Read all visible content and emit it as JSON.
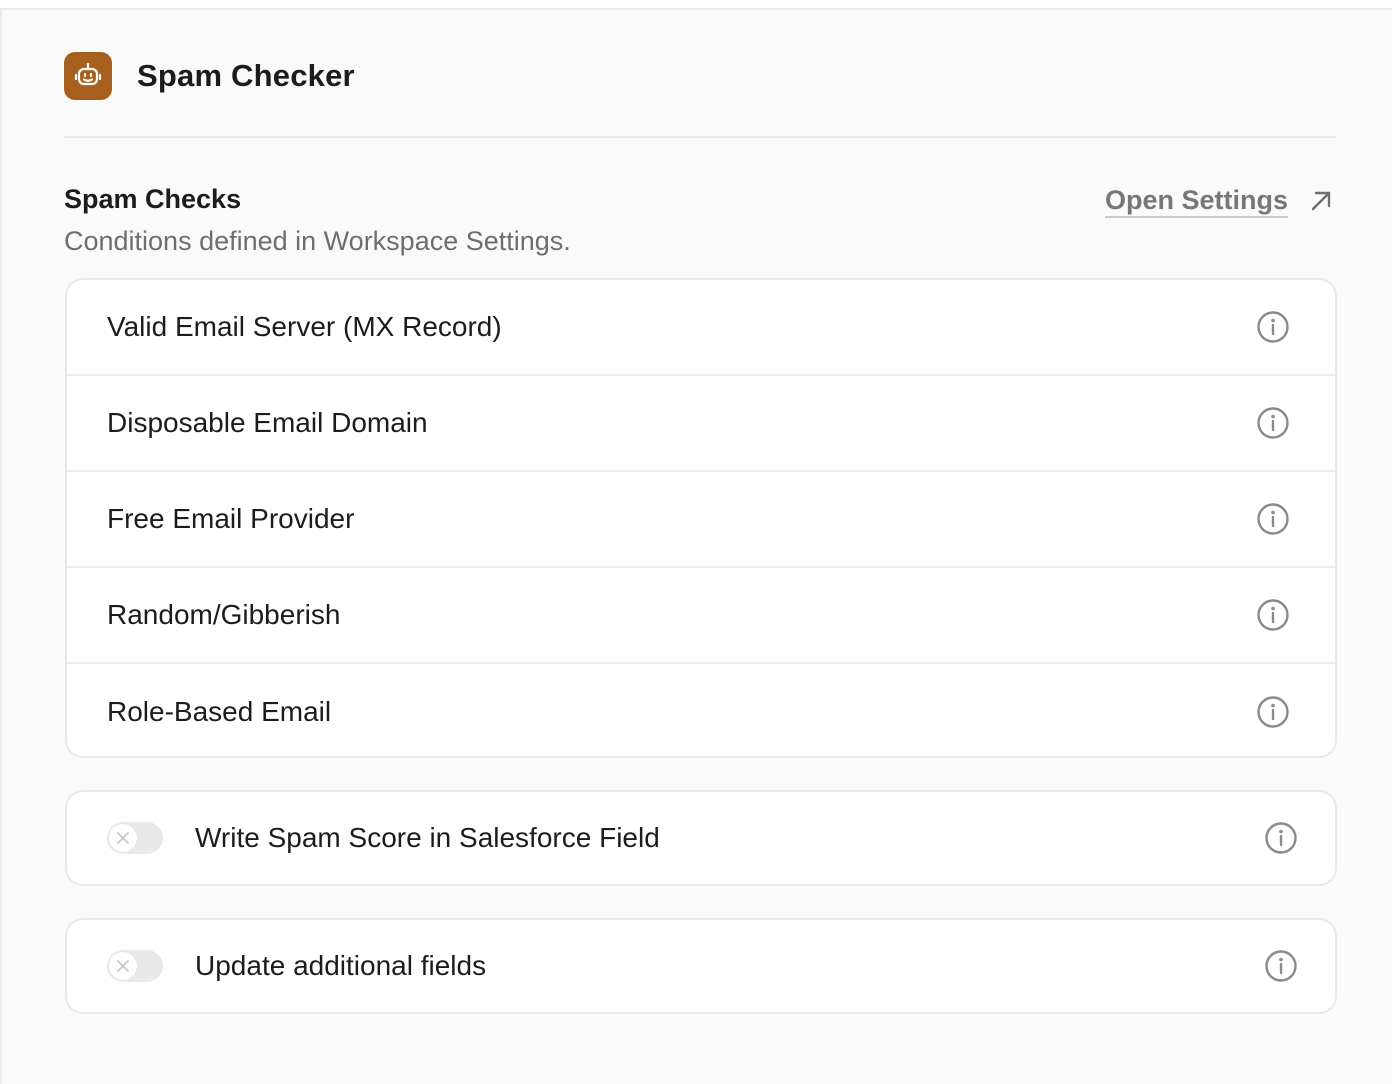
{
  "app": {
    "title": "Spam Checker",
    "icon": "robot-icon",
    "accent_color": "#a7601d"
  },
  "spam_checks": {
    "title": "Spam Checks",
    "subtitle": "Conditions defined in Workspace Settings.",
    "open_settings_label": "Open Settings",
    "open_settings_icon": "arrow-up-right-icon",
    "items": [
      {
        "label": "Valid Email Server (MX Record)",
        "icon": "info-icon"
      },
      {
        "label": "Disposable Email Domain",
        "icon": "info-icon"
      },
      {
        "label": "Free Email Provider",
        "icon": "info-icon"
      },
      {
        "label": "Random/Gibberish",
        "icon": "info-icon"
      },
      {
        "label": "Role-Based Email",
        "icon": "info-icon"
      }
    ]
  },
  "options": [
    {
      "label": "Write Spam Score in Salesforce Field",
      "enabled": false,
      "icon": "info-icon"
    },
    {
      "label": "Update additional fields",
      "enabled": false,
      "icon": "info-icon"
    }
  ]
}
